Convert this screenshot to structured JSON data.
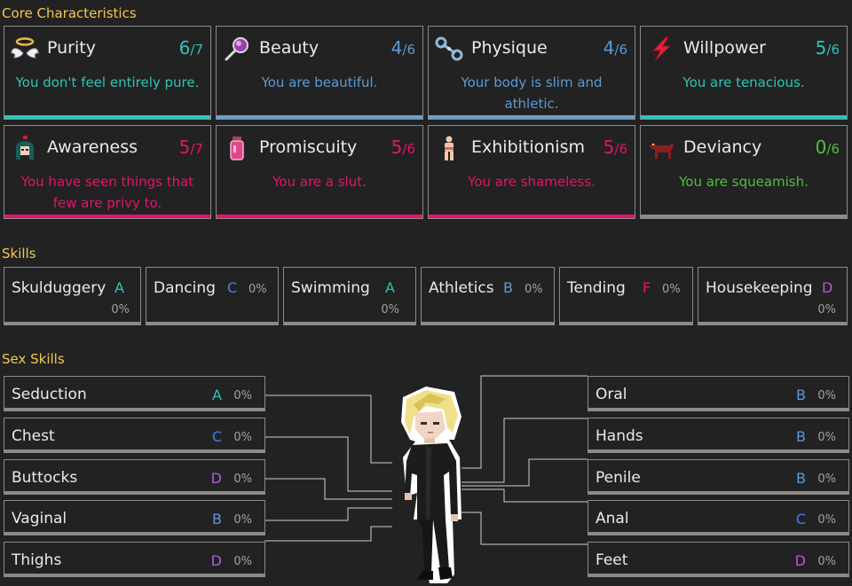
{
  "sections": {
    "core": "Core Characteristics",
    "skills": "Skills",
    "sex_skills": "Sex Skills"
  },
  "colors": {
    "teal": "#2ec4b6",
    "blue": "#5b9bd5",
    "pink": "#e5136b",
    "green": "#4cc23a",
    "purple": "#b45ad6",
    "cblue": "#4a7cf0",
    "grey": "#8a8a8a"
  },
  "core": [
    {
      "name": "Purity",
      "value": "6",
      "max": "/7",
      "desc": "You don't feel entirely pure.",
      "color": "#2ec4b6",
      "bar": "#2ec4b6",
      "icon": "halo-wings-icon"
    },
    {
      "name": "Beauty",
      "value": "4",
      "max": "/6",
      "desc": "You are beautiful.",
      "color": "#5b9bd5",
      "bar": "#6a9fc9",
      "icon": "hand-mirror-icon"
    },
    {
      "name": "Physique",
      "value": "4",
      "max": "/6",
      "desc": "Your body is slim and athletic.",
      "color": "#5b9bd5",
      "bar": "#6a9fc9",
      "icon": "dumbbell-icon"
    },
    {
      "name": "Willpower",
      "value": "5",
      "max": "/6",
      "desc": "You are tenacious.",
      "color": "#2ec4b6",
      "bar": "#2ec4b6",
      "icon": "lightning-bolt-icon"
    },
    {
      "name": "Awareness",
      "value": "5",
      "max": "/7",
      "desc": "You have seen things that few are privy to.",
      "color": "#e5136b",
      "bar": "#e5136b",
      "icon": "girl-portrait-icon"
    },
    {
      "name": "Promiscuity",
      "value": "5",
      "max": "/6",
      "desc": "You are a slut.",
      "color": "#e5136b",
      "bar": "#e5136b",
      "icon": "potion-jar-icon"
    },
    {
      "name": "Exhibitionism",
      "value": "5",
      "max": "/6",
      "desc": "You are shameless.",
      "color": "#e5136b",
      "bar": "#e5136b",
      "icon": "figure-icon"
    },
    {
      "name": "Deviancy",
      "value": "0",
      "max": "/6",
      "desc": "You are squeamish.",
      "color": "#4cc23a",
      "bar": "#8a8a8a",
      "icon": "dog-icon"
    }
  ],
  "skills": [
    {
      "name": "Skulduggery",
      "grade": "A",
      "pct": "0%",
      "color": "#2ec4b6"
    },
    {
      "name": "Dancing",
      "grade": "C",
      "pct": "0%",
      "color": "#4a7cf0"
    },
    {
      "name": "Swimming",
      "grade": "A",
      "pct": "0%",
      "color": "#2ec4b6"
    },
    {
      "name": "Athletics",
      "grade": "B",
      "pct": "0%",
      "color": "#5b9bd5"
    },
    {
      "name": "Tending",
      "grade": "F",
      "pct": "0%",
      "color": "#e5136b"
    },
    {
      "name": "Housekeeping",
      "grade": "D",
      "pct": "0%",
      "color": "#b45ad6"
    }
  ],
  "sex_left": [
    {
      "name": "Seduction",
      "grade": "A",
      "pct": "0%",
      "color": "#2ec4b6"
    },
    {
      "name": "Chest",
      "grade": "C",
      "pct": "0%",
      "color": "#4a7cf0"
    },
    {
      "name": "Buttocks",
      "grade": "D",
      "pct": "0%",
      "color": "#b45ad6"
    },
    {
      "name": "Vaginal",
      "grade": "B",
      "pct": "0%",
      "color": "#5b9bd5"
    },
    {
      "name": "Thighs",
      "grade": "D",
      "pct": "0%",
      "color": "#b45ad6"
    }
  ],
  "sex_right": [
    {
      "name": "Oral",
      "grade": "B",
      "pct": "0%",
      "color": "#5b9bd5"
    },
    {
      "name": "Hands",
      "grade": "B",
      "pct": "0%",
      "color": "#5b9bd5"
    },
    {
      "name": "Penile",
      "grade": "B",
      "pct": "0%",
      "color": "#5b9bd5"
    },
    {
      "name": "Anal",
      "grade": "C",
      "pct": "0%",
      "color": "#4a7cf0"
    },
    {
      "name": "Feet",
      "grade": "D",
      "pct": "0%",
      "color": "#b45ad6"
    }
  ]
}
